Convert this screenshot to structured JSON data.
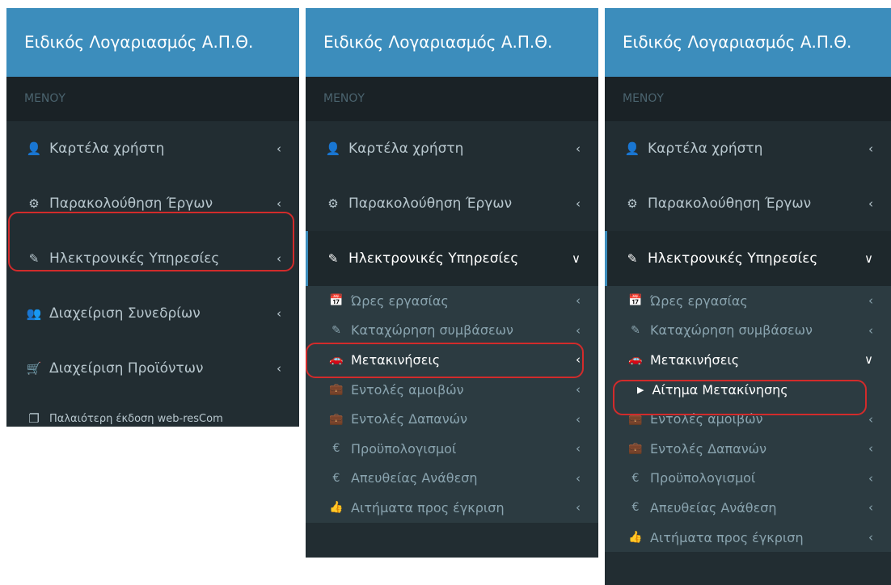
{
  "app_title": "Ειδικός Λογαριασμός Α.Π.Θ.",
  "menu_header": "ΜΕΝΟΥ",
  "items": {
    "user_card": "Καρτέλα χρήστη",
    "project_monitoring": "Παρακολούθηση Έργων",
    "e_services": "Ηλεκτρονικές Υπηρεσίες",
    "conferences": "Διαχείριση Συνεδρίων",
    "products": "Διαχείριση Προϊόντων",
    "old_version": "Παλαιότερη έκδοση web-resCom"
  },
  "submenu": {
    "work_hours": "Ώρες εργασίας",
    "contracts": "Καταχώρηση συμβάσεων",
    "travels": "Μετακινήσεις",
    "fee_orders": "Εντολές αμοιβών",
    "expense_orders": "Εντολές Δαπανών",
    "budgets": "Προϋπολογισμοί",
    "direct_award": "Απευθείας Ανάθεση",
    "approvals": "Αιτήματα προς έγκριση"
  },
  "travel_request": "Αίτημα Μετακίνησης",
  "icons": {
    "user": "user-icon",
    "gears": "gears-icon",
    "edit": "edit-icon",
    "users": "users-icon",
    "cart": "cart-icon",
    "copy": "copy-icon",
    "calendar": "calendar-icon",
    "car": "car-icon",
    "briefcase": "briefcase-icon",
    "euro": "euro-icon",
    "thumbs_up": "thumbs-up-icon",
    "caret": "caret-right-icon",
    "chevron_left": "chevron-left-icon",
    "chevron_down": "chevron-down-icon"
  },
  "colors": {
    "header_bg": "#3c8dbc",
    "sidebar_bg": "#222d32",
    "submenu_bg": "#2c3b41",
    "highlight_ring": "#d22b2b"
  }
}
